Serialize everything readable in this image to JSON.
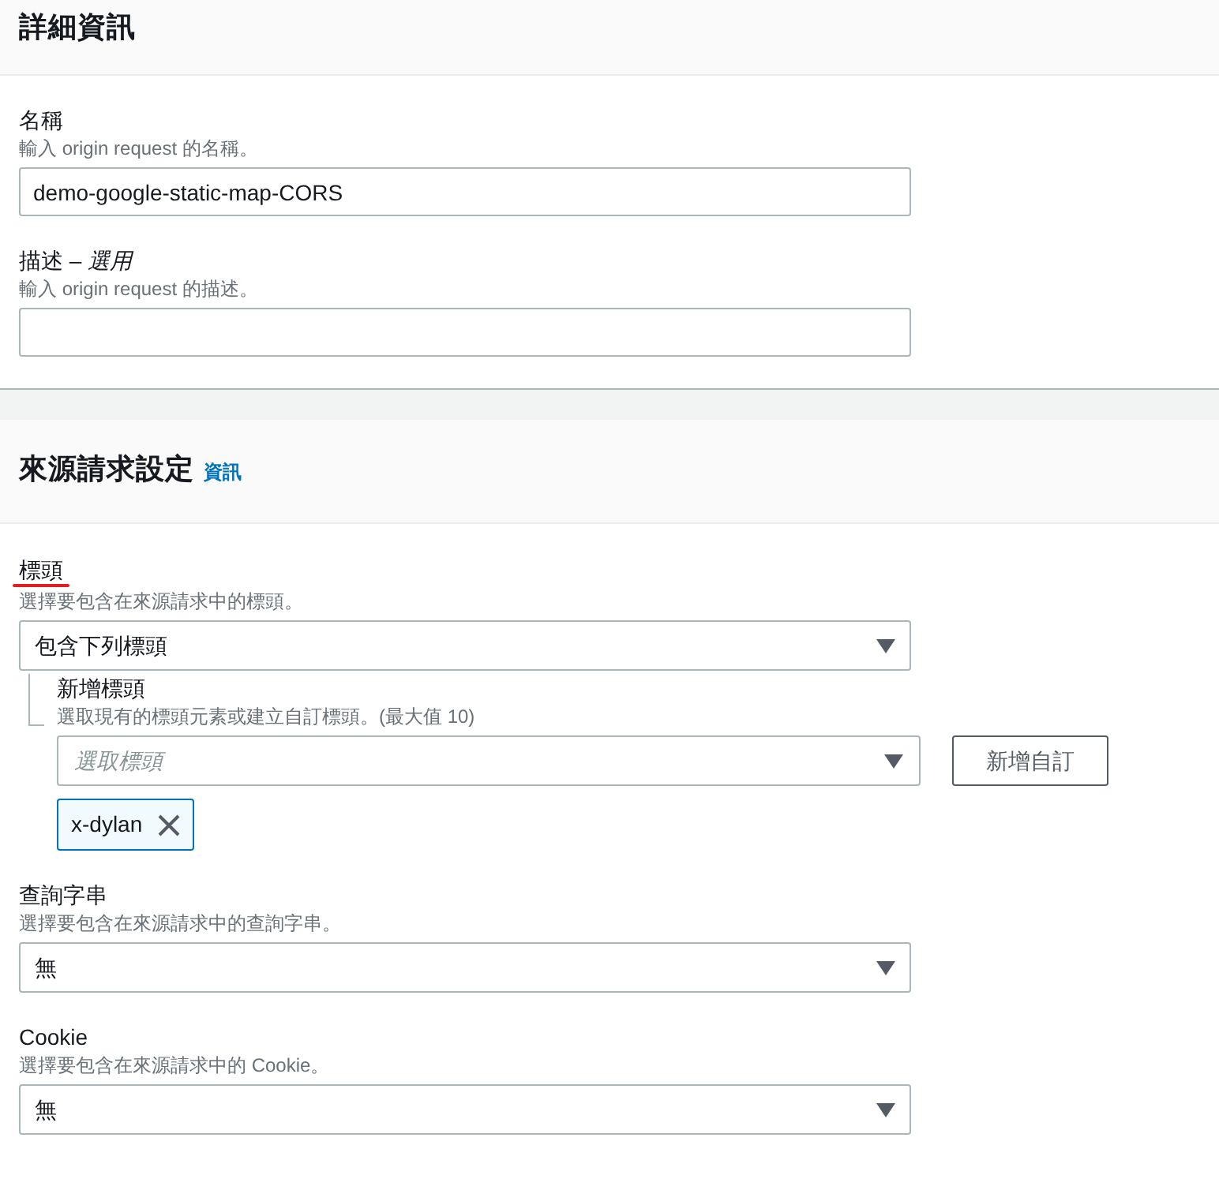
{
  "sections": [
    {
      "title": "詳細資訊",
      "fields": [
        {
          "kind": "text",
          "label": "名稱",
          "underlined": false,
          "hint": "輸入 origin request 的名稱。",
          "value": "demo-google-static-map-CORS"
        },
        {
          "kind": "text",
          "label": "描述 – *選用*",
          "underlined": false,
          "hint": "輸入 origin request 的描述。"
        }
      ]
    },
    {
      "title": "來源請求設定",
      "info_link": "資訊",
      "fields": [
        {
          "kind": "select",
          "label": "標頭",
          "underlined": true,
          "hint": "選擇要包含在來源請求中的標頭。",
          "value": "包含下列標頭",
          "children": [
            {
              "kind": "multiselect",
              "label": "新增標頭",
              "underlined": false,
              "hint": "選取現有的標頭元素或建立自訂標頭。(最大值 10)",
              "placeholder": "選取標頭",
              "button": "新增自訂",
              "tags": [
                {
                  "label": "x-dylan"
                }
              ]
            }
          ]
        },
        {
          "kind": "select",
          "label": "查詢字串",
          "underlined": false,
          "hint": "選擇要包含在來源請求中的查詢字串。",
          "value": "無"
        },
        {
          "kind": "select",
          "label": "Cookie",
          "underlined": false,
          "hint": "選擇要包含在來源請求中的 Cookie。",
          "value": "無"
        }
      ]
    }
  ]
}
